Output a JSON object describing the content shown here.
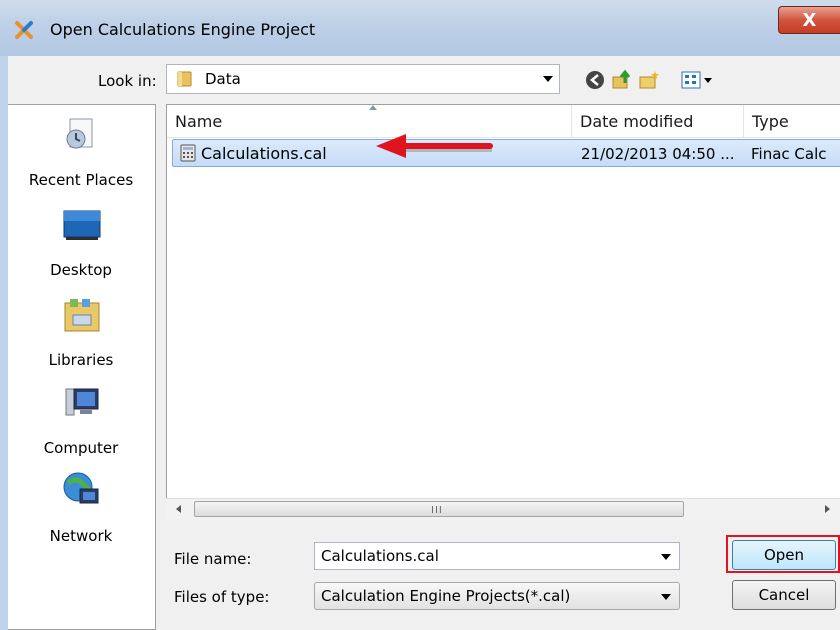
{
  "window": {
    "title": "Open Calculations Engine Project",
    "close_glyph": "X"
  },
  "toolbar": {
    "look_in_label": "Look in:",
    "look_in_value": "Data",
    "icons": [
      "back-icon",
      "up-folder-icon",
      "new-folder-icon",
      "views-menu-icon"
    ]
  },
  "places": [
    {
      "label": "Recent Places",
      "icon": "recent-places-icon"
    },
    {
      "label": "Desktop",
      "icon": "desktop-icon"
    },
    {
      "label": "Libraries",
      "icon": "libraries-icon"
    },
    {
      "label": "Computer",
      "icon": "computer-icon"
    },
    {
      "label": "Network",
      "icon": "network-icon"
    }
  ],
  "filelist": {
    "columns": [
      "Name",
      "Date modified",
      "Type"
    ],
    "rows": [
      {
        "name": "Calculations.cal",
        "date": "21/02/2013 04:50 ...",
        "type": "Finac Calc",
        "selected": true
      }
    ],
    "scroll_grip": "III"
  },
  "form": {
    "file_name_label": "File name:",
    "file_name_value": "Calculations.cal",
    "file_type_label": "Files of type:",
    "file_type_value": "Calculation Engine Projects(*.cal)"
  },
  "buttons": {
    "open": "Open",
    "cancel": "Cancel"
  },
  "colors": {
    "selection": "#c5dcf7",
    "annotation_red": "#e0141e",
    "titlebar": "#bfd3ea"
  }
}
